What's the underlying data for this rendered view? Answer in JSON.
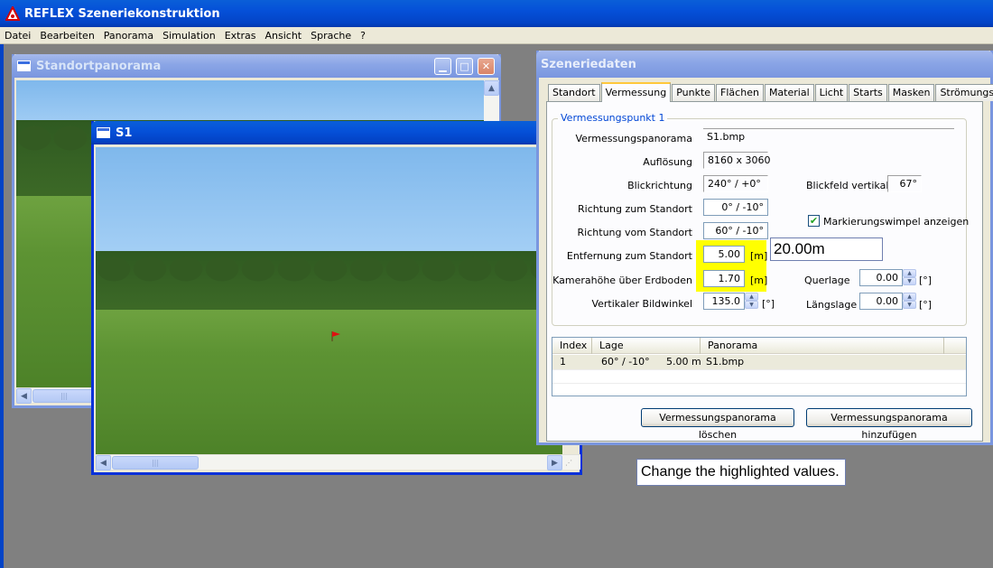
{
  "app": {
    "title": "REFLEX Szeneriekonstruktion"
  },
  "menubar": {
    "items": [
      "Datei",
      "Bearbeiten",
      "Panorama",
      "Simulation",
      "Extras",
      "Ansicht",
      "Sprache",
      "?"
    ]
  },
  "windows": {
    "standortpanorama": {
      "title": "Standortpanorama"
    },
    "s1": {
      "title": "S1"
    },
    "szeneriedaten": {
      "title": "Szeneriedaten"
    }
  },
  "tabs": [
    "Standort",
    "Vermessung",
    "Punkte",
    "Flächen",
    "Material",
    "Licht",
    "Starts",
    "Masken",
    "Strömungsfeld"
  ],
  "selected_tab": "Vermessung",
  "vermessung": {
    "group_title": "Vermessungspunkt 1",
    "panorama_label": "Vermessungspanorama",
    "panorama_value": "S1.bmp",
    "aufloesung_label": "Auflösung",
    "aufloesung_value": "8160 x 3060",
    "blickrichtung_label": "Blickrichtung",
    "blickrichtung_value": "240° /  +0°",
    "blickfeld_label": "Blickfeld vertikal",
    "blickfeld_value": "67°",
    "richtung_zum_label": "Richtung zum Standort",
    "richtung_zum_value": "0° /  -10°",
    "richtung_vom_label": "Richtung vom Standort",
    "richtung_vom_value": "60° /  -10°",
    "markierung_label": "Markierungswimpel anzeigen",
    "markierung_checked": true,
    "entfernung_label": "Entfernung zum Standort",
    "entfernung_value": "5.00",
    "entfernung_unit": "[m]",
    "kamerahoehe_label": "Kamerahöhe über Erdboden",
    "kamerahoehe_value": "1.70",
    "kamerahoehe_unit": "[m]",
    "querlage_label": "Querlage",
    "querlage_value": "0.00",
    "querlage_unit": "[°]",
    "bildwinkel_label": "Vertikaler Bildwinkel",
    "bildwinkel_value": "135.0",
    "bildwinkel_unit": "[°]",
    "laengslage_label": "Längslage",
    "laengslage_value": "0.00",
    "laengslage_unit": "[°]"
  },
  "listview": {
    "columns": [
      "Index",
      "Lage",
      "Panorama"
    ],
    "rows": [
      {
        "index": "1",
        "lage": "60° /  -10°",
        "distance": "5.00 m",
        "panorama": "S1.bmp"
      }
    ]
  },
  "buttons": {
    "delete": "Vermessungspanorama löschen",
    "add": "Vermessungspanorama hinzufügen"
  },
  "annotations": {
    "value_box": "20.00m",
    "instruction": "Change the highlighted values."
  },
  "colors": {
    "highlight": "#ffff00",
    "xp_blue": "#0343c6",
    "dialog_bg": "#ece9d8",
    "desktop": "#808080"
  }
}
